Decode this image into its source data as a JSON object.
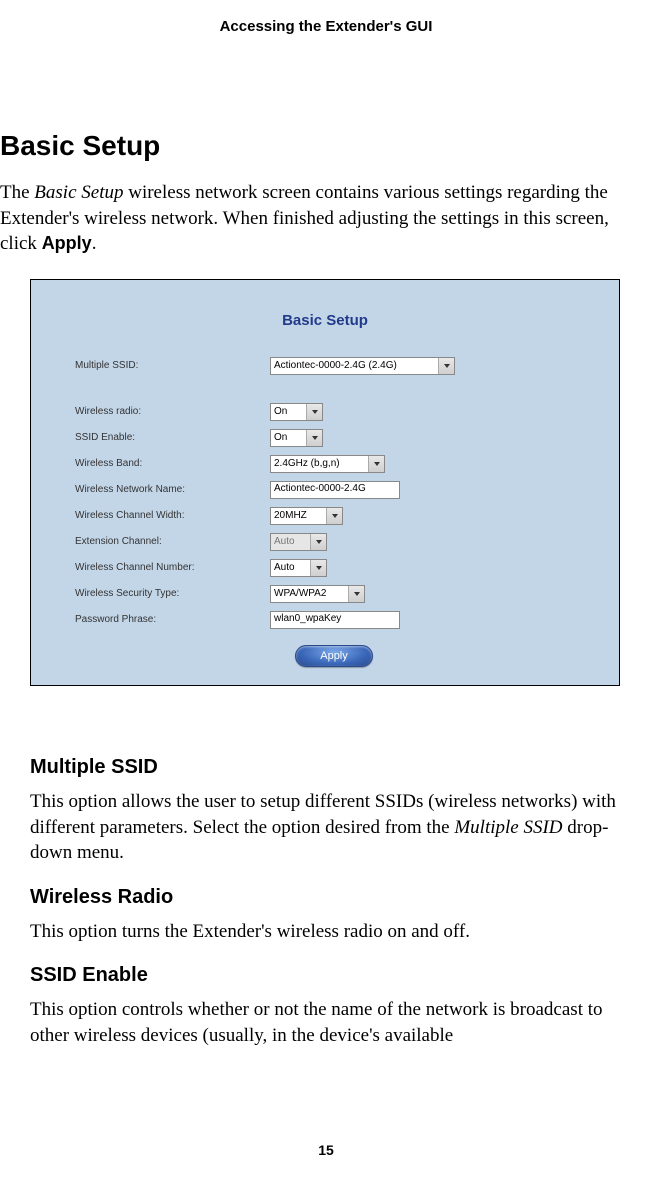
{
  "header": "Accessing the Extender's GUI",
  "h1": "Basic Setup",
  "intro_part1": "The ",
  "intro_italic": "Basic Setup",
  "intro_part2": " wireless network screen contains various settings regarding the Extender's wireless network. When finished adjusting the settings in this screen, click ",
  "intro_bold": "Apply",
  "intro_part3": ".",
  "panel": {
    "title": "Basic Setup",
    "fields": {
      "multiple_ssid": {
        "label": "Multiple SSID:",
        "value": "Actiontec-0000-2.4G (2.4G)"
      },
      "wireless_radio": {
        "label": "Wireless radio:",
        "value": "On"
      },
      "ssid_enable": {
        "label": "SSID Enable:",
        "value": "On"
      },
      "wireless_band": {
        "label": "Wireless Band:",
        "value": "2.4GHz (b,g,n)"
      },
      "network_name": {
        "label": "Wireless Network Name:",
        "value": "Actiontec-0000-2.4G"
      },
      "channel_width": {
        "label": "Wireless Channel Width:",
        "value": "20MHZ"
      },
      "extension_channel": {
        "label": "Extension Channel:",
        "value": "Auto"
      },
      "channel_number": {
        "label": "Wireless Channel Number:",
        "value": "Auto"
      },
      "security_type": {
        "label": "Wireless Security Type:",
        "value": "WPA/WPA2"
      },
      "password": {
        "label": "Password Phrase:",
        "value": "wlan0_wpaKey"
      }
    },
    "apply_label": "Apply"
  },
  "sections": {
    "s1_title": "Multiple SSID",
    "s1_p1": "This option allows the user to setup different SSIDs (wireless networks) with different parameters. Select the option desired from the ",
    "s1_italic": "Multiple SSID",
    "s1_p2": " drop-down menu.",
    "s2_title": "Wireless Radio",
    "s2_body": "This option turns the Extender's wireless radio on and off.",
    "s3_title": "SSID Enable",
    "s3_body": "This option controls whether or not the name of the network is broadcast to other wireless devices (usually, in the device's available"
  },
  "page_number": "15"
}
